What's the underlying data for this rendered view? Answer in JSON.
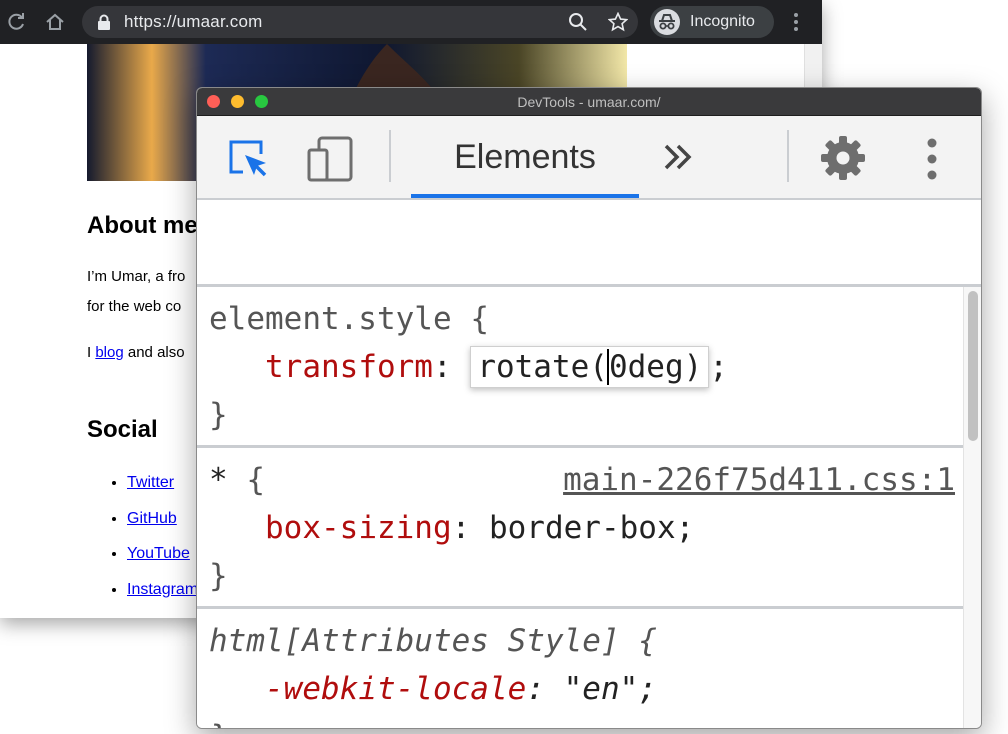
{
  "browser": {
    "url": "https://umaar.com",
    "incognito_label": "Incognito",
    "icons": {
      "reload": "reload-icon",
      "home": "home-icon",
      "lock": "lock-icon",
      "zoom": "zoom-icon",
      "bookmark": "star-icon",
      "incognito": "incognito-icon",
      "menu": "kebab-menu-icon"
    }
  },
  "page": {
    "about_heading": "About me",
    "about_p1": "I’m Umar, a fro",
    "about_p2": "for the web co",
    "about_p3_prefix": "I ",
    "about_p3_link": "blog",
    "about_p3_suffix": " and also",
    "social_heading": "Social",
    "social_links": [
      "Twitter",
      "GitHub",
      "YouTube",
      "Instagram"
    ]
  },
  "devtools": {
    "window_title": "DevTools - umaar.com/",
    "active_tab": "Elements",
    "accent_color": "#1a73e8",
    "icons": {
      "inspect": "inspect-element-icon",
      "device": "device-toolbar-icon",
      "more_tabs": "chevron-double-right-icon",
      "settings": "gear-icon",
      "menu": "kebab-menu-icon"
    },
    "styles": {
      "rule1": {
        "selector": "element.style",
        "open": "{",
        "close": "}",
        "property": "transform",
        "value_before_caret": "rotate(",
        "value_after_caret": "0deg)",
        "semicolon": ";"
      },
      "rule2": {
        "selector": "*",
        "open": "{",
        "close": "}",
        "source": "main-226f75d411.css:1",
        "property": "box-sizing",
        "value": "border-box",
        "semicolon": ";"
      },
      "rule3": {
        "selector": "html[Attributes Style]",
        "open": "{",
        "close": "}",
        "property": "-webkit-locale",
        "value": "\"en\"",
        "semicolon": ";"
      }
    }
  }
}
